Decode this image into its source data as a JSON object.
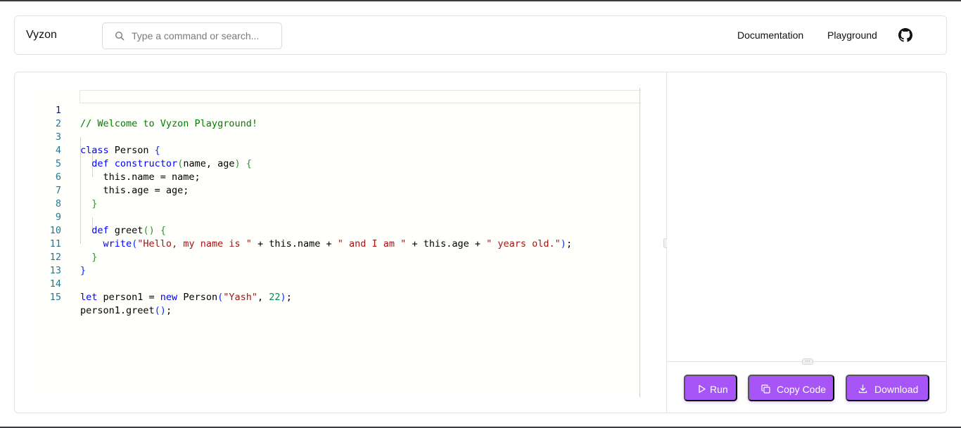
{
  "navbar": {
    "brand": "Vyzon",
    "search_placeholder": "Type a command or search...",
    "links": [
      "Documentation",
      "Playground"
    ],
    "github_icon": "github-icon"
  },
  "editor": {
    "line_numbers": [
      "1",
      "2",
      "3",
      "4",
      "5",
      "6",
      "7",
      "8",
      "9",
      "10",
      "11",
      "12",
      "13",
      "14",
      "15"
    ],
    "active_line": 1,
    "tokens": {
      "l1_comment": "// Welcome to Vyzon Playground!",
      "l3_class": "class",
      "l3_name": " Person ",
      "l3_brace": "{",
      "l4_def": "def",
      "l4_ctor": " constructor",
      "l4_paren_open": "(",
      "l4_params": "name, age",
      "l4_paren_close": ")",
      "l4_brace": " {",
      "l5_text": "this.name = name;",
      "l6_text": "this.age = age;",
      "l7_brace": "}",
      "l9_def": "def",
      "l9_name": " greet",
      "l9_parens": "()",
      "l9_brace": " {",
      "l10_write": "write",
      "l10_paren_open": "(",
      "l10_s1": "\"Hello, my name is \"",
      "l10_op1": " + this.name + ",
      "l10_s2": "\" and I am \"",
      "l10_op2": " + this.age + ",
      "l10_s3": "\" years old.\"",
      "l10_paren_close": ")",
      "l10_semi": ";",
      "l11_brace": "}",
      "l12_brace": "}",
      "l14_let": "let",
      "l14_var": " person1 = ",
      "l14_new": "new",
      "l14_cls": " Person",
      "l14_paren_open": "(",
      "l14_str": "\"Yash\"",
      "l14_comma": ", ",
      "l14_num": "22",
      "l14_paren_close": ")",
      "l14_semi": ";",
      "l15_obj": "person1.greet",
      "l15_parens": "()",
      "l15_semi": ";"
    }
  },
  "actions": {
    "run_label": "Run",
    "copy_label": "Copy Code",
    "download_label": "Download"
  },
  "colors": {
    "accent": "#a855f7",
    "comment": "#008000",
    "keyword": "#0000ff",
    "string": "#a31515",
    "number": "#098658"
  }
}
